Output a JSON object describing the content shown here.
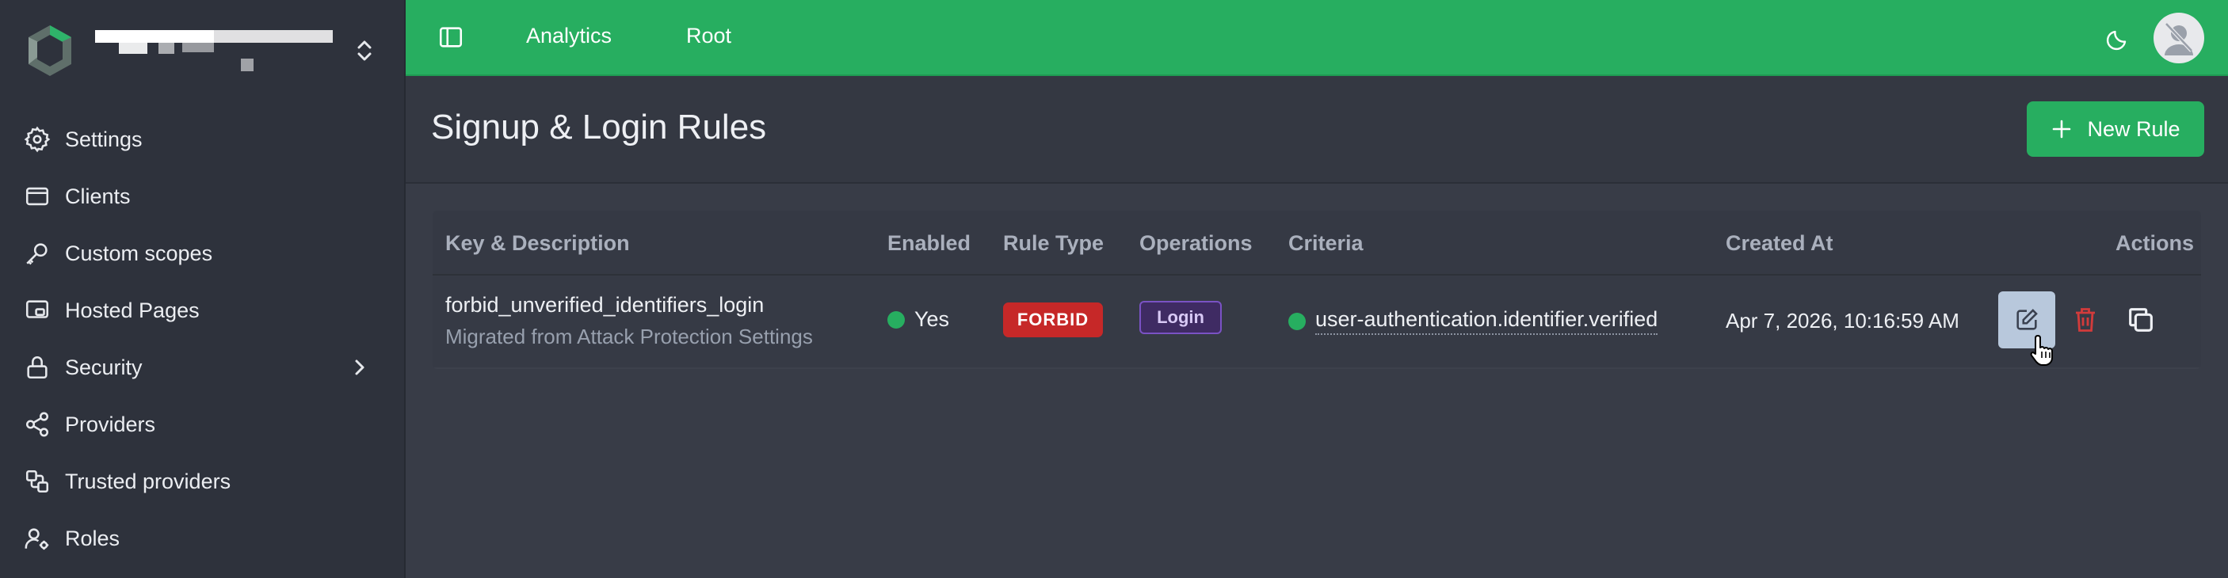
{
  "sidebar": {
    "items": [
      {
        "label": "Settings",
        "icon": "gear-icon"
      },
      {
        "label": "Clients",
        "icon": "window-icon"
      },
      {
        "label": "Custom scopes",
        "icon": "key-icon"
      },
      {
        "label": "Hosted Pages",
        "icon": "hosted-pages-icon"
      },
      {
        "label": "Security",
        "icon": "lock-icon"
      },
      {
        "label": "Providers",
        "icon": "share-icon"
      },
      {
        "label": "Trusted providers",
        "icon": "trusted-providers-icon"
      },
      {
        "label": "Roles",
        "icon": "user-cog-icon"
      }
    ]
  },
  "topbar": {
    "links": [
      "Analytics",
      "Root"
    ]
  },
  "page": {
    "title": "Signup & Login Rules",
    "new_rule_label": "New Rule"
  },
  "table": {
    "headers": [
      "Key & Description",
      "Enabled",
      "Rule Type",
      "Operations",
      "Criteria",
      "Created At",
      "Actions"
    ],
    "rows": [
      {
        "key": "forbid_unverified_identifiers_login",
        "description": "Migrated from Attack Protection Settings",
        "enabled": "Yes",
        "rule_type": "FORBID",
        "operation": "Login",
        "criteria": "user-authentication.identifier.verified",
        "created_at": "Apr 7, 2026, 10:16:59 AM"
      }
    ]
  },
  "colors": {
    "accent": "#27ae60",
    "danger": "#c62828",
    "operation_badge": "#7a52c4"
  }
}
